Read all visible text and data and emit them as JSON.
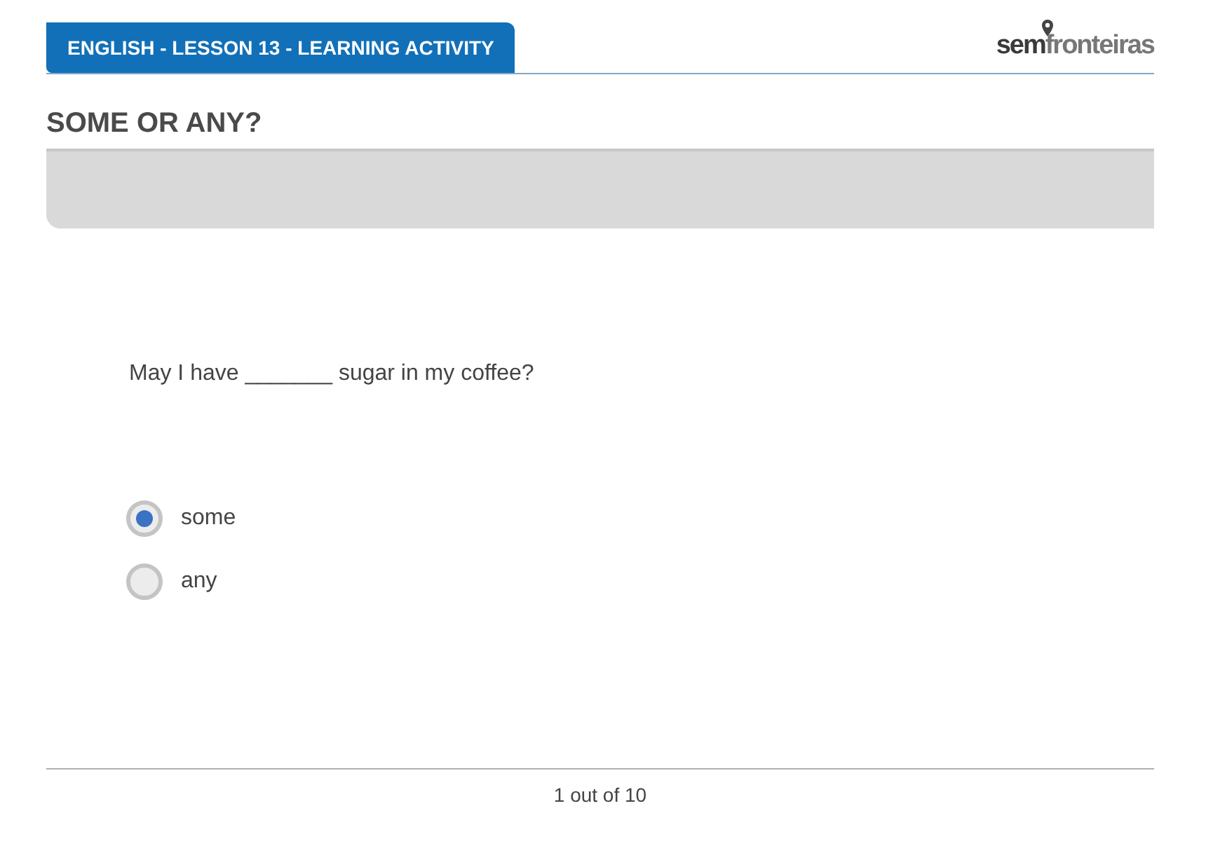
{
  "header": {
    "title": "ENGLISH - LESSON 13 - LEARNING ACTIVITY",
    "logo": {
      "part_1": "sem",
      "part_2": "fronteiras"
    }
  },
  "heading": "SOME OR ANY?",
  "question": "May I have _______ sugar in my coffee?",
  "options": [
    {
      "label": "some",
      "selected": true
    },
    {
      "label": "any",
      "selected": false
    }
  ],
  "progress": "1 out of 10"
}
